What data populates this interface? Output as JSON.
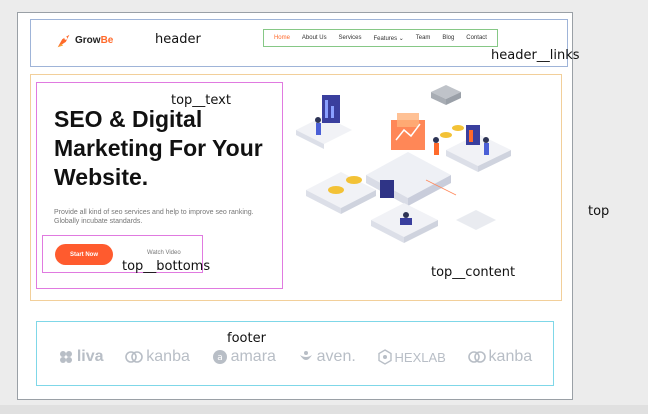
{
  "header": {
    "label": "header",
    "logo": {
      "name_part1": "Grow",
      "name_part2": "Be"
    }
  },
  "header_links": {
    "label": "header__links",
    "items": [
      "Home",
      "About Us",
      "Services",
      "Features ⌄",
      "Team",
      "Blog",
      "Contact"
    ]
  },
  "top": {
    "label": "top",
    "top_text": {
      "label": "top__text",
      "headline": "SEO & Digital Marketing For Your Website.",
      "description": "Provide all kind of seo services and help to improve seo ranking. Globally incubate standards."
    },
    "top_bottoms": {
      "label": "top__bottoms",
      "primary_button": "Start Now",
      "secondary_button": "Watch Video"
    },
    "top_content": {
      "label": "top__content"
    }
  },
  "footer": {
    "label": "footer",
    "brands": [
      "liva",
      "kanba",
      "amara",
      "aven.",
      "HEXLAB",
      "kanba"
    ]
  },
  "colors": {
    "accent": "#ff6a2b",
    "brand_gray": "#b8bec6"
  }
}
